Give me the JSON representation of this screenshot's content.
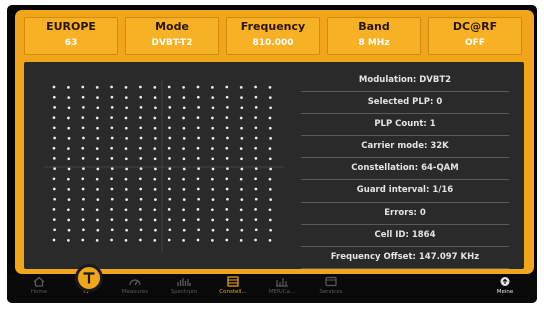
{
  "header_tiles": [
    {
      "key": "EUROPE",
      "value": "63"
    },
    {
      "key": "Mode",
      "value": "DVBT-T2"
    },
    {
      "key": "Frequency",
      "value": "810.000"
    },
    {
      "key": "Band",
      "value": "8 MHz"
    },
    {
      "key": "DC@RF",
      "value": "OFF"
    }
  ],
  "info_lines": [
    "Modulation: DVBT2",
    "Selected PLP: 0",
    "PLP Count: 1",
    "Carrier mode: 32K",
    "Constellation: 64-QAM",
    "Guard interval: 1/16",
    "Errors: 0",
    "Cell ID: 1864",
    "Frequency Offset: 147.097 KHz"
  ],
  "constellation": {
    "order": 64,
    "grid": 16
  },
  "nav": [
    {
      "label": "Home",
      "icon": "home-icon"
    },
    {
      "label": "TV",
      "icon": "tv-icon"
    },
    {
      "label": "Measures",
      "icon": "gauge-icon"
    },
    {
      "label": "Spectrum",
      "icon": "spectrum-icon"
    },
    {
      "label": "Constell...",
      "icon": "constellation-icon"
    },
    {
      "label": "MER/Ca...",
      "icon": "chart-icon"
    },
    {
      "label": "Services",
      "icon": "services-icon"
    },
    {
      "label": "Meine",
      "icon": "menu-icon"
    }
  ],
  "colors": {
    "accent": "#f0a51a",
    "panel": "#2a2a2a",
    "active": "#f0a51a",
    "inactive": "#5a5a5a"
  }
}
